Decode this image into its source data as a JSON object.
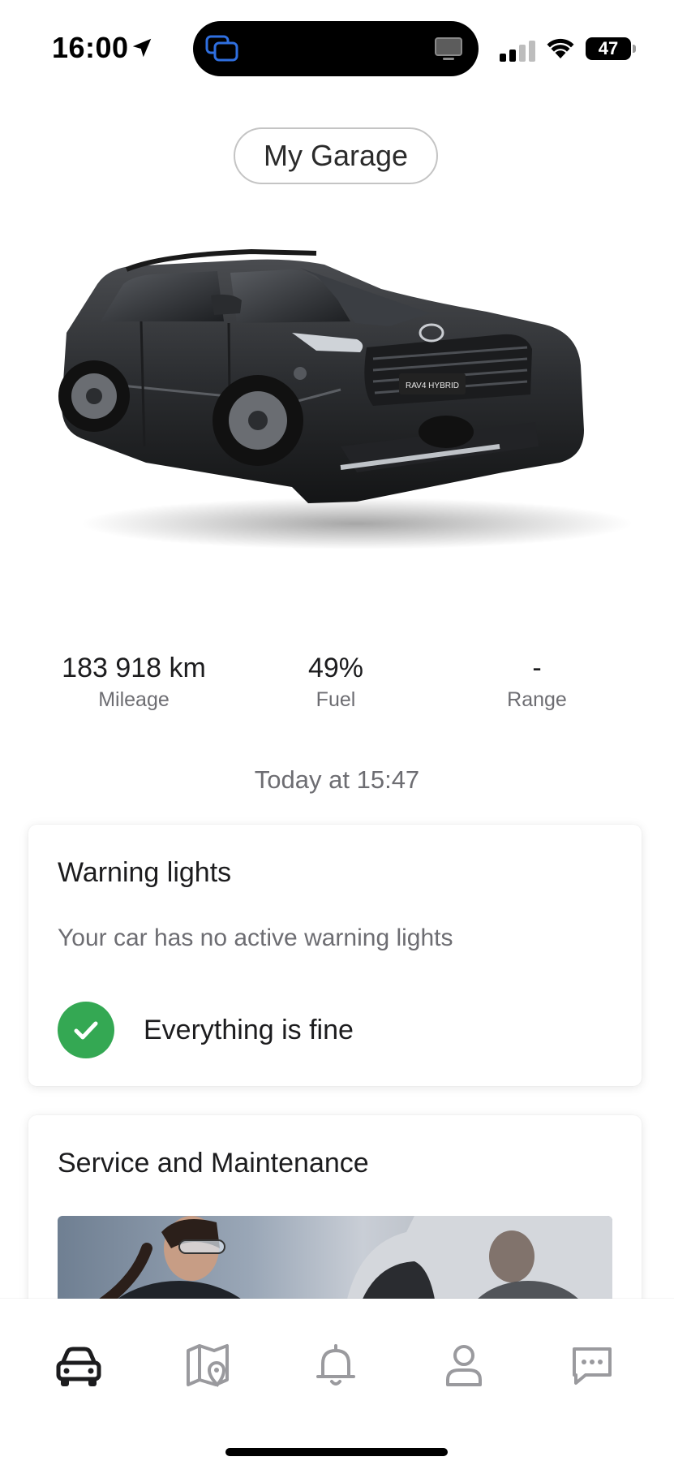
{
  "status_bar": {
    "time": "16:00",
    "battery": "47",
    "battery_level": 0.47
  },
  "header": {
    "garage_button": "My Garage"
  },
  "car": {
    "plate_text": "RAV4 HYBRID",
    "body_color": "#2b2d30"
  },
  "stats": [
    {
      "value": "183 918 km",
      "label": "Mileage"
    },
    {
      "value": "49%",
      "label": "Fuel"
    },
    {
      "value": "-",
      "label": "Range"
    }
  ],
  "updated": "Today at 15:47",
  "warning_card": {
    "title": "Warning lights",
    "subtitle": "Your car has no active warning lights",
    "status": "Everything is fine",
    "status_color": "#34a853"
  },
  "service_card": {
    "title": "Service and Maintenance"
  },
  "tab_bar": {
    "tabs": [
      {
        "icon": "car-icon",
        "active": true
      },
      {
        "icon": "map-icon",
        "active": false
      },
      {
        "icon": "bell-icon",
        "active": false
      },
      {
        "icon": "profile-icon",
        "active": false
      },
      {
        "icon": "chat-icon",
        "active": false
      }
    ],
    "active_color": "#1c1c1e",
    "inactive_color": "#9a9a9e"
  }
}
